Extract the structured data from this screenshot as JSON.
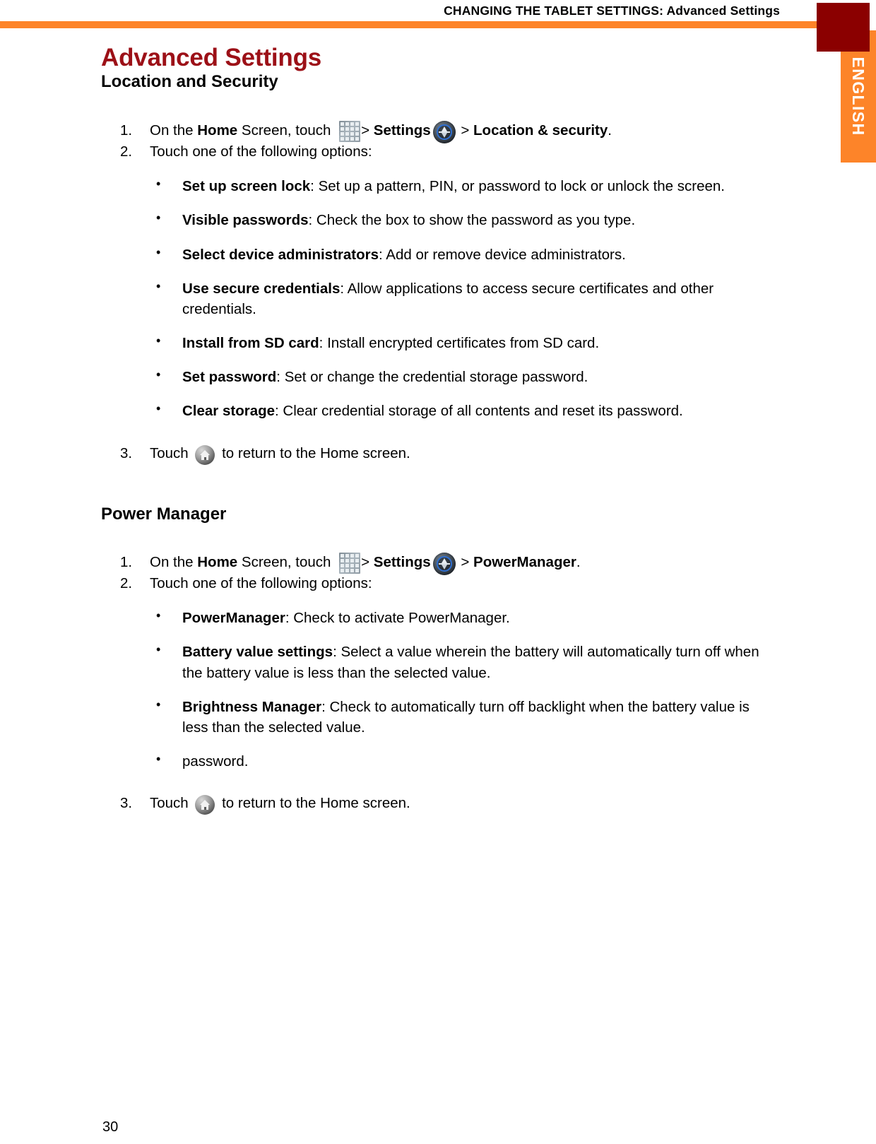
{
  "header": {
    "running_head": "CHANGING THE TABLET SETTINGS: Advanced Settings",
    "tab_label": "ENGLISH",
    "rule_color": "#FD8429",
    "tab_box_color": "#8B0000"
  },
  "doc": {
    "title": "Advanced Settings",
    "title_color": "#9C1017",
    "page_number": "30"
  },
  "sections": [
    {
      "heading": "Location and Security",
      "step1": {
        "number": "1.",
        "t1": "On the ",
        "b1": "Home",
        "t2": " Screen, touch ",
        "icon1": "grid-icon",
        "t3": "> ",
        "b2": "Settings",
        "icon2": "settings-icon",
        "t4": " > ",
        "b3": "Location & security",
        "t5": "."
      },
      "step2": {
        "number": "2.",
        "text": "Touch one of the following options:"
      },
      "options": [
        {
          "bullet": "•",
          "term": "Set up screen lock",
          "desc": ": Set up a pattern, PIN, or password to lock or unlock the screen."
        },
        {
          "bullet": "•",
          "term": "Visible passwords",
          "desc": ": Check the box to show the password as you type."
        },
        {
          "bullet": "•",
          "term": "Select device administrators",
          "desc": ": Add or remove device administrators."
        },
        {
          "bullet": "•",
          "term": "Use secure credentials",
          "desc": ": Allow applications to access secure certificates and other credentials."
        },
        {
          "bullet": "•",
          "term": "Install from SD card",
          "desc": ": Install encrypted certificates from SD card."
        },
        {
          "bullet": "•",
          "term": "Set password",
          "desc": ": Set or change the credential storage password."
        },
        {
          "bullet": "•",
          "term": "Clear storage",
          "desc": ": Clear credential storage of all contents and reset its password."
        }
      ],
      "step3": {
        "number": "3.",
        "t1": "Touch ",
        "icon": "home-icon",
        "t2": "  to return to the Home screen."
      }
    },
    {
      "heading": "Power Manager",
      "step1": {
        "number": "1.",
        "t1": "On the ",
        "b1": "Home",
        "t2": " Screen, touch ",
        "icon1": "grid-icon",
        "t3": "> ",
        "b2": "Settings",
        "icon2": "settings-icon",
        "t4": " > ",
        "b3": "PowerManager",
        "t5": "."
      },
      "step2": {
        "number": "2.",
        "text": "Touch one of the following options:"
      },
      "options": [
        {
          "bullet": "•",
          "term": "PowerManager",
          "desc": ": Check to activate PowerManager."
        },
        {
          "bullet": "•",
          "term": "Battery value settings",
          "desc": ": Select a value wherein the battery will automatically turn off when the battery value is less than the selected value."
        },
        {
          "bullet": "•",
          "term": "Brightness Manager",
          "desc": ": Check to automatically turn off backlight when the battery value is less than the selected value."
        },
        {
          "bullet": "•",
          "term": "",
          "desc": "password."
        }
      ],
      "step3": {
        "number": "3.",
        "t1": "Touch ",
        "icon": "home-icon",
        "t2": " to return to the Home screen."
      }
    }
  ]
}
